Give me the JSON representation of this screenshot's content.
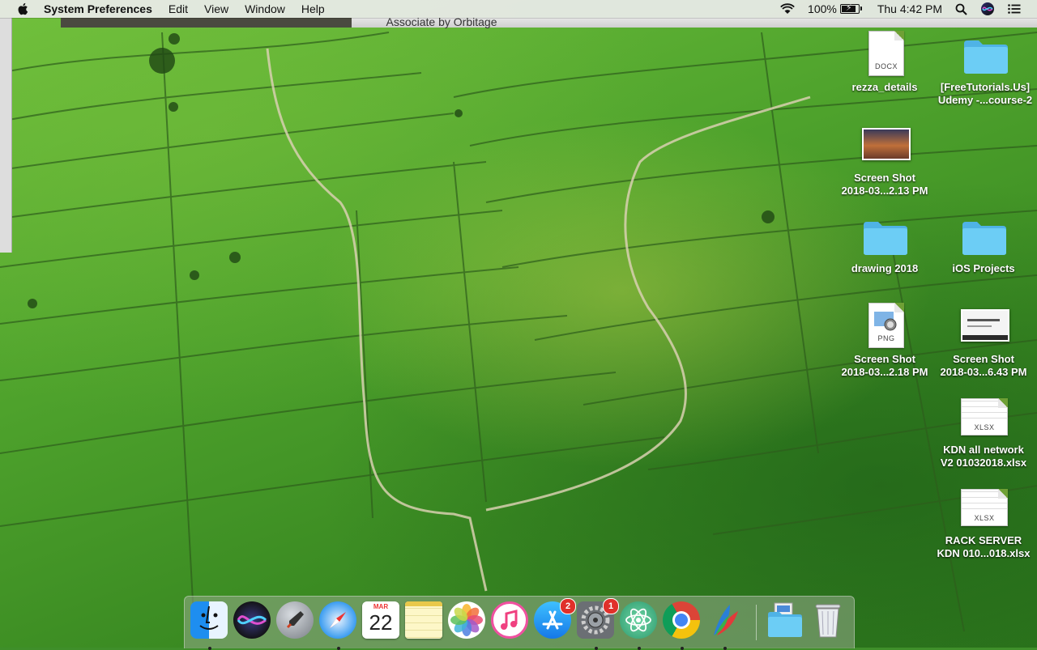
{
  "menubar": {
    "app_name": "System Preferences",
    "menus": [
      "Edit",
      "View",
      "Window",
      "Help"
    ],
    "battery_percent": "100%",
    "clock": "Thu 4:42 PM"
  },
  "background_window": {
    "title": "Associate by Orbitage"
  },
  "desktop_icons": [
    {
      "label_1": "rezza_details",
      "label_2": "",
      "kind": "docx",
      "tag": "DOCX"
    },
    {
      "label_1": "[FreeTutorials.Us]",
      "label_2": "Udemy -...course-2",
      "kind": "folder"
    },
    {
      "label_1": "Screen Shot",
      "label_2": "2018-03...2.13 PM",
      "kind": "screenshot"
    },
    {
      "label_1": "drawing 2018",
      "label_2": "",
      "kind": "folder"
    },
    {
      "label_1": "iOS Projects",
      "label_2": "",
      "kind": "folder"
    },
    {
      "label_1": "Screen Shot",
      "label_2": "2018-03...2.18 PM",
      "kind": "png",
      "tag": "PNG"
    },
    {
      "label_1": "Screen Shot",
      "label_2": "2018-03...6.43 PM",
      "kind": "screenshot"
    },
    {
      "label_1": "KDN all network",
      "label_2": "V2 01032018.xlsx",
      "kind": "xlsx",
      "tag": "XLSX"
    },
    {
      "label_1": "RACK SERVER",
      "label_2": "KDN 010...018.xlsx",
      "kind": "xlsx",
      "tag": "XLSX"
    }
  ],
  "dock": {
    "apps": [
      {
        "name": "finder-icon",
        "running": true
      },
      {
        "name": "siri-icon",
        "running": false
      },
      {
        "name": "launchpad-icon",
        "running": false
      },
      {
        "name": "safari-icon",
        "running": true
      },
      {
        "name": "calendar-icon",
        "running": false,
        "month": "MAR",
        "day": "22"
      },
      {
        "name": "notes-icon",
        "running": false
      },
      {
        "name": "photos-icon",
        "running": false
      },
      {
        "name": "itunes-icon",
        "running": false
      },
      {
        "name": "app-store-icon",
        "running": false,
        "badge": "2"
      },
      {
        "name": "system-preferences-icon",
        "running": true,
        "badge": "1"
      },
      {
        "name": "atom-icon",
        "running": true
      },
      {
        "name": "chrome-icon",
        "running": true
      },
      {
        "name": "feather-icon",
        "running": true
      },
      {
        "name": "downloads-folder-icon",
        "running": false
      },
      {
        "name": "trash-icon",
        "running": false
      }
    ]
  },
  "colors": {
    "folder": "#5ec4f0",
    "badge": "#e0302a"
  }
}
